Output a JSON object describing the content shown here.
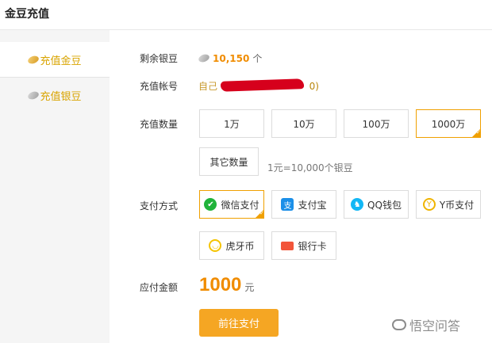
{
  "header": {
    "title": "金豆充值"
  },
  "sidebar": {
    "items": [
      {
        "label": "充值金豆",
        "icon": "gold-bean-icon",
        "active": true
      },
      {
        "label": "充值银豆",
        "icon": "silver-bean-icon",
        "active": false
      }
    ]
  },
  "form": {
    "balance": {
      "label": "剩余银豆",
      "value": "10,150",
      "unit": "个"
    },
    "account": {
      "label": "充值帐号",
      "self": "自己",
      "id_tail": "0)"
    },
    "quantity": {
      "label": "充值数量",
      "options": [
        "1万",
        "10万",
        "100万",
        "1000万"
      ],
      "selected": "1000万",
      "other": "其它数量",
      "rate": "1元=10,000个银豆"
    },
    "payment": {
      "label": "支付方式",
      "methods": [
        {
          "label": "微信支付",
          "icon": "wechat-icon",
          "glyph": "✔"
        },
        {
          "label": "支付宝",
          "icon": "alipay-icon",
          "glyph": "支"
        },
        {
          "label": "QQ钱包",
          "icon": "qq-icon",
          "glyph": "♞"
        },
        {
          "label": "Y币支付",
          "icon": "y-coin-icon",
          "glyph": "Y"
        },
        {
          "label": "虎牙币",
          "icon": "huya-coin-icon",
          "glyph": "◡"
        },
        {
          "label": "银行卡",
          "icon": "bank-card-icon",
          "glyph": ""
        }
      ],
      "selected": "微信支付"
    },
    "total": {
      "label": "应付金额",
      "value": "1000",
      "unit": "元"
    },
    "submit_label": "前往支付"
  },
  "watermark": {
    "text": "悟空问答"
  },
  "colors": {
    "accent": "#f08c00",
    "gold": "#d9a400",
    "button": "#f5a623",
    "border": "#dcdcdc"
  }
}
